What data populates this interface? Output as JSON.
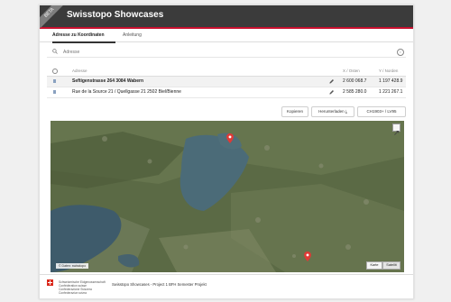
{
  "app": {
    "title": "Swisstopo Showcases",
    "ribbon": "BETA"
  },
  "tabs": [
    {
      "label": "Adresse zu Koordinaten",
      "active": true
    },
    {
      "label": "Anleitung",
      "active": false
    }
  ],
  "search": {
    "placeholder": "Adresse",
    "value": ""
  },
  "table": {
    "headers": {
      "address": "Adresse",
      "x": "X / Osten",
      "y": "Y / Norden"
    },
    "rows": [
      {
        "address": "Seftigenstrasse 264 3084 Wabern",
        "x": "2 600 068.7",
        "y": "1 197 428.9",
        "selected": true
      },
      {
        "address": "Rue de la Source 21 / Quellgasse 21 2502 Biel/Bienne",
        "x": "2 585 280.0",
        "y": "1 221 267.1",
        "selected": false
      }
    ]
  },
  "buttons": {
    "copy": "Kopieren",
    "download": "Herunterladen ⤓",
    "crs": "CH1903+ / LV95"
  },
  "map": {
    "attribution": "© Daten: swisstopo",
    "btn_map": "Karte",
    "btn_satellite": "Satellit"
  },
  "footer": {
    "confed_lines": [
      "Schweizerische Eidgenossenschaft",
      "Confédération suisse",
      "Confederazione Svizzera",
      "Confederaziun svizra"
    ],
    "text": "Swisstopo Showcases - Project 1 BFH Semester Projekt"
  },
  "colors": {
    "header": "#3b3b3b",
    "accent": "#c8102e",
    "flag": "#da291c",
    "marker": "#e03a36"
  }
}
